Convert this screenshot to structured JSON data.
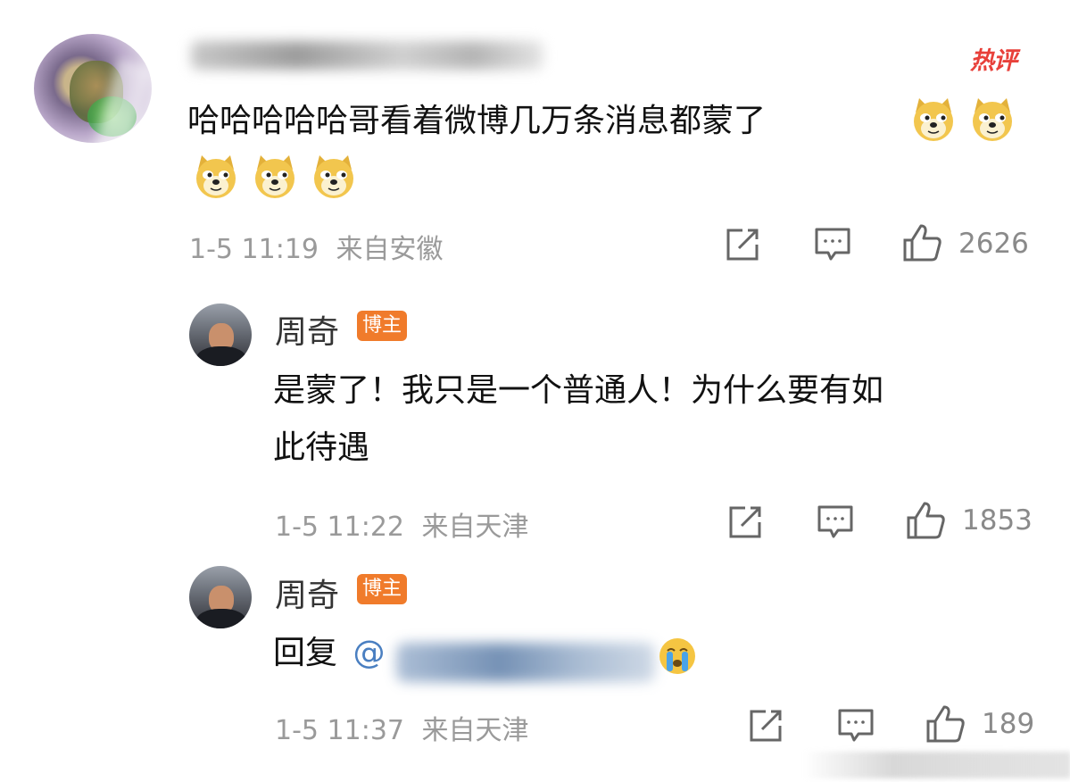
{
  "hot_tag": "热评",
  "comments": [
    {
      "text_line1": "哈哈哈哈哈哥看着微博几万条消息都蒙了",
      "time": "1-5 11:19",
      "location": "来自安徽",
      "likes": "2626"
    },
    {
      "author": "周奇",
      "badge": "博主",
      "text_line1": "是蒙了！我只是一个普通人！为什么要有如",
      "text_line2": "此待遇",
      "time": "1-5 11:22",
      "location": "来自天津",
      "likes": "1853"
    },
    {
      "author": "周奇",
      "badge": "博主",
      "reply_prefix": "回复",
      "mention_start": "@",
      "time": "1-5 11:37",
      "location": "来自天津",
      "likes": "189"
    }
  ],
  "icons": [
    "share-icon",
    "comment-icon",
    "like-icon",
    "doge-emoji-icon",
    "crying-emoji-icon"
  ],
  "colors": {
    "hot": "#e8403a",
    "badge": "#f07b2b",
    "mention": "#4a7fc1",
    "meta": "#9a9a9a"
  }
}
